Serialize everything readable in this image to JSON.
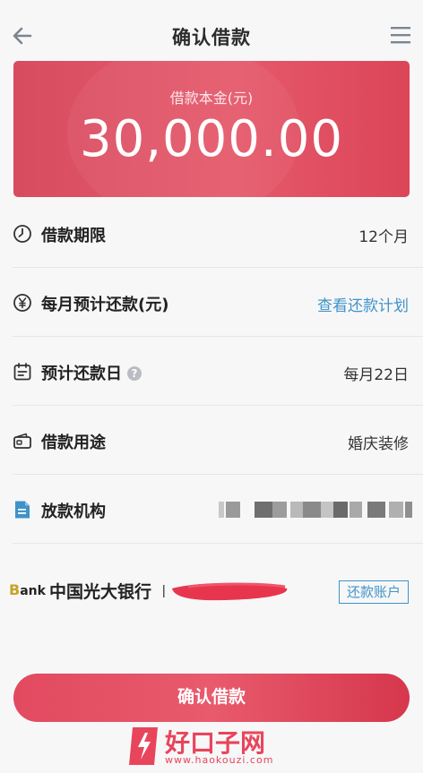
{
  "header": {
    "title": "确认借款"
  },
  "amount_card": {
    "label": "借款本金(元)",
    "value": "30,000.00"
  },
  "rows": [
    {
      "label": "借款期限",
      "value": "12个月",
      "icon": "clock-icon"
    },
    {
      "label": "每月预计还款(元)",
      "value": "查看还款计划",
      "icon": "yen-circle-icon"
    },
    {
      "label": "预计还款日",
      "value": "每月22日",
      "icon": "calendar-icon"
    },
    {
      "label": "借款用途",
      "value": "婚庆装修",
      "icon": "wallet-icon"
    },
    {
      "label": "放款机构",
      "value": "",
      "icon": "document-icon"
    }
  ],
  "bank": {
    "logo_prefix": "B",
    "logo_text": "ank",
    "name": "中国光大银行",
    "repay_account_label": "还款账户"
  },
  "confirm_button": {
    "label": "确认借款"
  },
  "watermark": {
    "brand": "好口子网",
    "url": "www.haokouzi.com"
  },
  "colors": {
    "accent_red": "#e24a60",
    "link_blue": "#3f93c8"
  }
}
